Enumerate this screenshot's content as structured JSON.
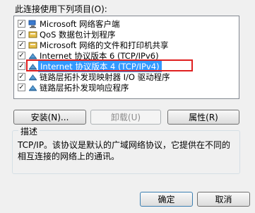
{
  "header": {
    "label": "此连接使用下列项目(O):"
  },
  "items": [
    {
      "label": "Microsoft 网络客户端",
      "checked": true,
      "icon": "network-client-icon"
    },
    {
      "label": "QoS 数据包计划程序",
      "checked": true,
      "icon": "service-icon"
    },
    {
      "label": "Microsoft 网络的文件和打印机共享",
      "checked": true,
      "icon": "service-icon"
    },
    {
      "label": "Internet 协议版本 6 (TCP/IPv6)",
      "checked": true,
      "icon": "protocol-icon"
    },
    {
      "label": "Internet 协议版本 4 (TCP/IPv4)",
      "checked": true,
      "icon": "protocol-icon",
      "selected": true
    },
    {
      "label": "链路层拓扑发现映射器 I/O 驱动程序",
      "checked": true,
      "icon": "protocol-icon"
    },
    {
      "label": "链路层拓扑发现响应程序",
      "checked": true,
      "icon": "protocol-icon"
    }
  ],
  "buttons": {
    "install": "安装(N)...",
    "uninstall": "卸载(U)",
    "properties": "属性(R)",
    "ok": "确定",
    "cancel": "取消"
  },
  "description": {
    "title": "描述",
    "text": "TCP/IP。该协议是默认的广域网络协议，它提供在不同的相互连接的网络上的通讯。"
  },
  "colors": {
    "selection": "#3399ff",
    "highlight_border": "#e02020"
  }
}
